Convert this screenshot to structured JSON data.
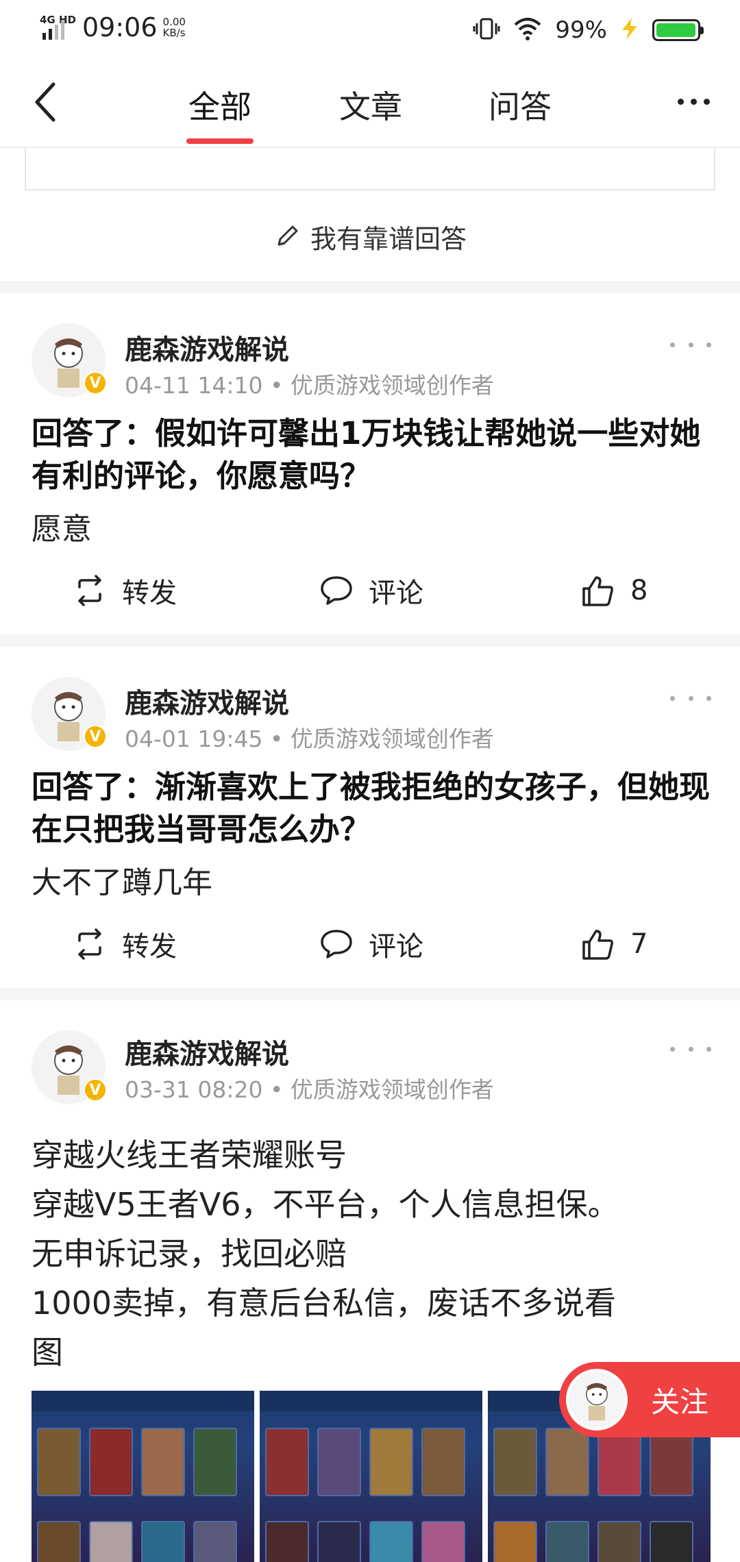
{
  "status_bar": {
    "network": "4G HD",
    "time": "09:06",
    "speed_value": "0.00",
    "speed_unit": "KB/s",
    "battery_percent": "99%",
    "battery_level": 0.99,
    "icons": [
      "signal-icon",
      "vibrate-icon",
      "wifi-icon",
      "charging-icon",
      "battery-icon"
    ]
  },
  "nav": {
    "tabs": [
      {
        "label": "全部",
        "active": true
      },
      {
        "label": "文章",
        "active": false
      },
      {
        "label": "问答",
        "active": false
      }
    ],
    "accent_color": "#f04142"
  },
  "answer_prompt": "我有靠谱回答",
  "posts": [
    {
      "author": "鹿森游戏解说",
      "meta": "04-11 14:10 • 优质游戏领域创作者",
      "question": "回答了：假如许可馨出1万块钱让帮她说一些对她有利的评论，你愿意吗？",
      "answer": "愿意",
      "actions": {
        "repost": "转发",
        "comment": "评论",
        "likes": "8"
      }
    },
    {
      "author": "鹿森游戏解说",
      "meta": "04-01 19:45 • 优质游戏领域创作者",
      "question": "回答了：渐渐喜欢上了被我拒绝的女孩子，但她现在只把我当哥哥怎么办？",
      "answer": "大不了蹲几年",
      "actions": {
        "repost": "转发",
        "comment": "评论",
        "likes": "7"
      }
    },
    {
      "author": "鹿森游戏解说",
      "meta": "03-31 08:20 • 优质游戏领域创作者",
      "body_lines": [
        "穿越火线王者荣耀账号",
        "穿越V5王者V6，不平台，个人信息担保。",
        "无申诉记录，找回必赔",
        "1000卖掉，有意后台私信，废话不多说看",
        "图"
      ]
    }
  ],
  "follow_button": "关注",
  "verified_badge": "V"
}
